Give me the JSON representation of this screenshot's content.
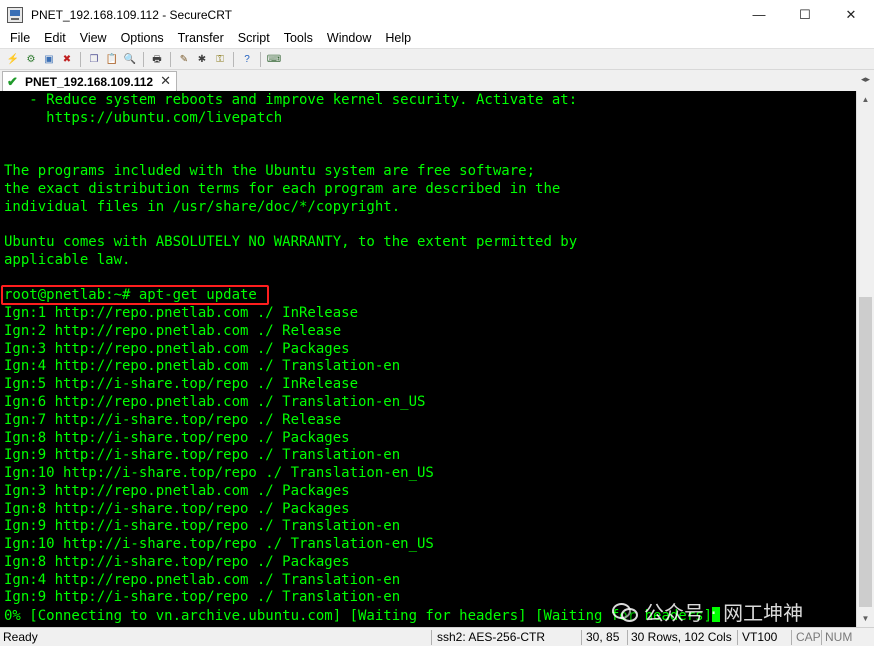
{
  "window": {
    "title": "PNET_192.168.109.112 - SecureCRT",
    "minimize_glyph": "—",
    "maximize_glyph": "☐",
    "close_glyph": "✕"
  },
  "menu": {
    "items": [
      "File",
      "Edit",
      "View",
      "Options",
      "Transfer",
      "Script",
      "Tools",
      "Window",
      "Help"
    ]
  },
  "toolbar": {
    "groups": [
      [
        {
          "icon": "connect-icon",
          "glyph": "⚡",
          "color": "#3a6fb5"
        },
        {
          "icon": "quick-connect-icon",
          "glyph": "⚙",
          "color": "#2f7a2f"
        },
        {
          "icon": "connect-tab-icon",
          "glyph": "▣",
          "color": "#3a6fb5"
        },
        {
          "icon": "disconnect-icon",
          "glyph": "✖",
          "color": "#c02020"
        }
      ],
      [
        {
          "icon": "copy-icon",
          "glyph": "❐",
          "color": "#5a5a9a"
        },
        {
          "icon": "paste-icon",
          "glyph": "📋",
          "color": "#8a6a2a"
        },
        {
          "icon": "find-icon",
          "glyph": "🔍",
          "color": "#404040"
        }
      ],
      [
        {
          "icon": "print-icon",
          "glyph": "🖶",
          "color": "#404040"
        }
      ],
      [
        {
          "icon": "session-options-icon",
          "glyph": "✎",
          "color": "#7a5a2a"
        },
        {
          "icon": "global-options-icon",
          "glyph": "✱",
          "color": "#404040"
        },
        {
          "icon": "key-icon",
          "glyph": "⚿",
          "color": "#8a7a1a"
        }
      ],
      [
        {
          "icon": "help-icon",
          "glyph": "?",
          "color": "#1f5fbf"
        }
      ],
      [
        {
          "icon": "keymap-icon",
          "glyph": "⌨",
          "color": "#3a6a3a"
        }
      ]
    ]
  },
  "tab": {
    "label": "PNET_192.168.109.112",
    "status_glyph": "✔",
    "close_glyph": "✕",
    "scroll_glyph": "◂▸"
  },
  "terminal": {
    "lines": [
      "   - Reduce system reboots and improve kernel security. Activate at:",
      "     https://ubuntu.com/livepatch",
      "",
      "",
      "The programs included with the Ubuntu system are free software;",
      "the exact distribution terms for each program are described in the",
      "individual files in /usr/share/doc/*/copyright.",
      "",
      "Ubuntu comes with ABSOLUTELY NO WARRANTY, to the extent permitted by",
      "applicable law.",
      "",
      "root@pnetlab:~# apt-get update",
      "Ign:1 http://repo.pnetlab.com ./ InRelease",
      "Ign:2 http://repo.pnetlab.com ./ Release",
      "Ign:3 http://repo.pnetlab.com ./ Packages",
      "Ign:4 http://repo.pnetlab.com ./ Translation-en",
      "Ign:5 http://i-share.top/repo ./ InRelease",
      "Ign:6 http://repo.pnetlab.com ./ Translation-en_US",
      "Ign:7 http://i-share.top/repo ./ Release",
      "Ign:8 http://i-share.top/repo ./ Packages",
      "Ign:9 http://i-share.top/repo ./ Translation-en",
      "Ign:10 http://i-share.top/repo ./ Translation-en_US",
      "Ign:3 http://repo.pnetlab.com ./ Packages",
      "Ign:8 http://i-share.top/repo ./ Packages",
      "Ign:9 http://i-share.top/repo ./ Translation-en",
      "Ign:10 http://i-share.top/repo ./ Translation-en_US",
      "Ign:8 http://i-share.top/repo ./ Packages",
      "Ign:4 http://repo.pnetlab.com ./ Translation-en",
      "Ign:9 http://i-share.top/repo ./ Translation-en",
      "0% [Connecting to vn.archive.ubuntu.com] [Waiting for headers] [Waiting for headers]"
    ],
    "text_color": "#00ff00",
    "background": "#000000",
    "highlight_color": "#ff1e1e"
  },
  "scrollbar": {
    "up_glyph": "▲",
    "down_glyph": "▼"
  },
  "watermark": {
    "text": "公众号 · 网工坤神"
  },
  "status": {
    "ready": "Ready",
    "cipher": "ssh2: AES-256-CTR",
    "cursor_pos": "30,  85",
    "size": "30 Rows, 102 Cols",
    "terminal_type": "VT100",
    "caps": "CAP",
    "num": "NUM"
  }
}
